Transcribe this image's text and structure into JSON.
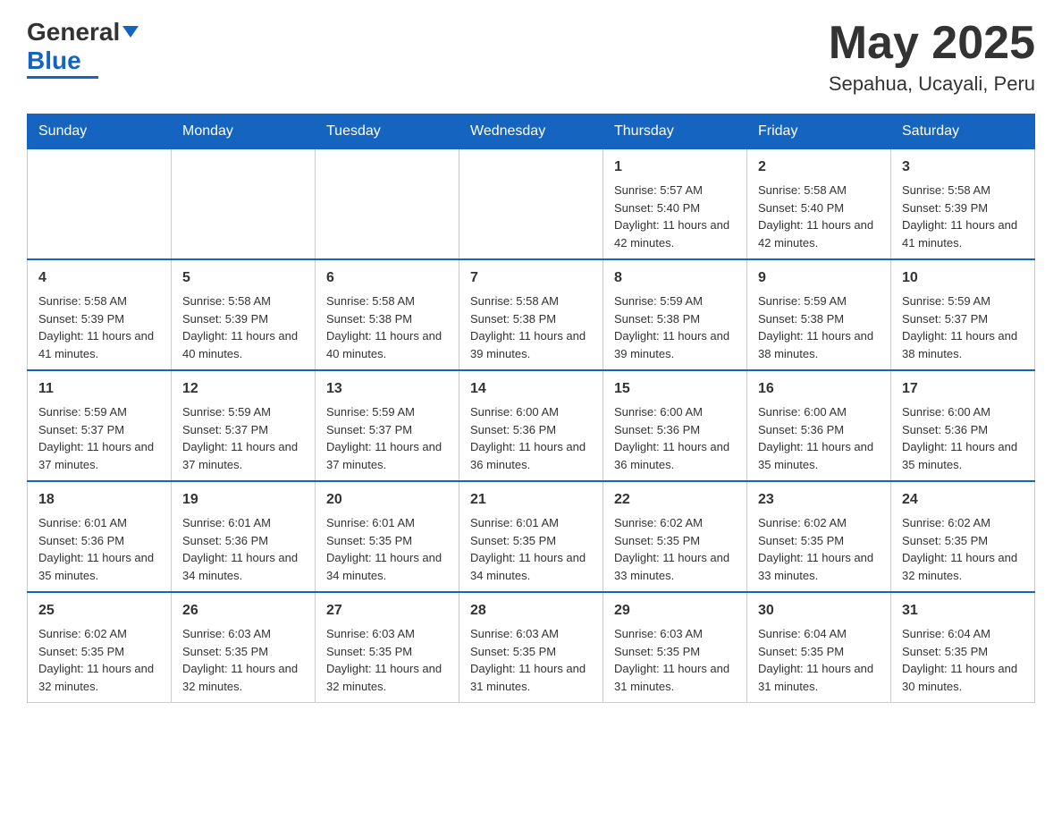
{
  "header": {
    "logo_general": "General",
    "logo_blue": "Blue",
    "month_year": "May 2025",
    "location": "Sepahua, Ucayali, Peru"
  },
  "days_of_week": [
    "Sunday",
    "Monday",
    "Tuesday",
    "Wednesday",
    "Thursday",
    "Friday",
    "Saturday"
  ],
  "weeks": [
    [
      {
        "day": "",
        "info": ""
      },
      {
        "day": "",
        "info": ""
      },
      {
        "day": "",
        "info": ""
      },
      {
        "day": "",
        "info": ""
      },
      {
        "day": "1",
        "info": "Sunrise: 5:57 AM\nSunset: 5:40 PM\nDaylight: 11 hours and 42 minutes."
      },
      {
        "day": "2",
        "info": "Sunrise: 5:58 AM\nSunset: 5:40 PM\nDaylight: 11 hours and 42 minutes."
      },
      {
        "day": "3",
        "info": "Sunrise: 5:58 AM\nSunset: 5:39 PM\nDaylight: 11 hours and 41 minutes."
      }
    ],
    [
      {
        "day": "4",
        "info": "Sunrise: 5:58 AM\nSunset: 5:39 PM\nDaylight: 11 hours and 41 minutes."
      },
      {
        "day": "5",
        "info": "Sunrise: 5:58 AM\nSunset: 5:39 PM\nDaylight: 11 hours and 40 minutes."
      },
      {
        "day": "6",
        "info": "Sunrise: 5:58 AM\nSunset: 5:38 PM\nDaylight: 11 hours and 40 minutes."
      },
      {
        "day": "7",
        "info": "Sunrise: 5:58 AM\nSunset: 5:38 PM\nDaylight: 11 hours and 39 minutes."
      },
      {
        "day": "8",
        "info": "Sunrise: 5:59 AM\nSunset: 5:38 PM\nDaylight: 11 hours and 39 minutes."
      },
      {
        "day": "9",
        "info": "Sunrise: 5:59 AM\nSunset: 5:38 PM\nDaylight: 11 hours and 38 minutes."
      },
      {
        "day": "10",
        "info": "Sunrise: 5:59 AM\nSunset: 5:37 PM\nDaylight: 11 hours and 38 minutes."
      }
    ],
    [
      {
        "day": "11",
        "info": "Sunrise: 5:59 AM\nSunset: 5:37 PM\nDaylight: 11 hours and 37 minutes."
      },
      {
        "day": "12",
        "info": "Sunrise: 5:59 AM\nSunset: 5:37 PM\nDaylight: 11 hours and 37 minutes."
      },
      {
        "day": "13",
        "info": "Sunrise: 5:59 AM\nSunset: 5:37 PM\nDaylight: 11 hours and 37 minutes."
      },
      {
        "day": "14",
        "info": "Sunrise: 6:00 AM\nSunset: 5:36 PM\nDaylight: 11 hours and 36 minutes."
      },
      {
        "day": "15",
        "info": "Sunrise: 6:00 AM\nSunset: 5:36 PM\nDaylight: 11 hours and 36 minutes."
      },
      {
        "day": "16",
        "info": "Sunrise: 6:00 AM\nSunset: 5:36 PM\nDaylight: 11 hours and 35 minutes."
      },
      {
        "day": "17",
        "info": "Sunrise: 6:00 AM\nSunset: 5:36 PM\nDaylight: 11 hours and 35 minutes."
      }
    ],
    [
      {
        "day": "18",
        "info": "Sunrise: 6:01 AM\nSunset: 5:36 PM\nDaylight: 11 hours and 35 minutes."
      },
      {
        "day": "19",
        "info": "Sunrise: 6:01 AM\nSunset: 5:36 PM\nDaylight: 11 hours and 34 minutes."
      },
      {
        "day": "20",
        "info": "Sunrise: 6:01 AM\nSunset: 5:35 PM\nDaylight: 11 hours and 34 minutes."
      },
      {
        "day": "21",
        "info": "Sunrise: 6:01 AM\nSunset: 5:35 PM\nDaylight: 11 hours and 34 minutes."
      },
      {
        "day": "22",
        "info": "Sunrise: 6:02 AM\nSunset: 5:35 PM\nDaylight: 11 hours and 33 minutes."
      },
      {
        "day": "23",
        "info": "Sunrise: 6:02 AM\nSunset: 5:35 PM\nDaylight: 11 hours and 33 minutes."
      },
      {
        "day": "24",
        "info": "Sunrise: 6:02 AM\nSunset: 5:35 PM\nDaylight: 11 hours and 32 minutes."
      }
    ],
    [
      {
        "day": "25",
        "info": "Sunrise: 6:02 AM\nSunset: 5:35 PM\nDaylight: 11 hours and 32 minutes."
      },
      {
        "day": "26",
        "info": "Sunrise: 6:03 AM\nSunset: 5:35 PM\nDaylight: 11 hours and 32 minutes."
      },
      {
        "day": "27",
        "info": "Sunrise: 6:03 AM\nSunset: 5:35 PM\nDaylight: 11 hours and 32 minutes."
      },
      {
        "day": "28",
        "info": "Sunrise: 6:03 AM\nSunset: 5:35 PM\nDaylight: 11 hours and 31 minutes."
      },
      {
        "day": "29",
        "info": "Sunrise: 6:03 AM\nSunset: 5:35 PM\nDaylight: 11 hours and 31 minutes."
      },
      {
        "day": "30",
        "info": "Sunrise: 6:04 AM\nSunset: 5:35 PM\nDaylight: 11 hours and 31 minutes."
      },
      {
        "day": "31",
        "info": "Sunrise: 6:04 AM\nSunset: 5:35 PM\nDaylight: 11 hours and 30 minutes."
      }
    ]
  ],
  "colors": {
    "header_bg": "#1565c0",
    "header_text": "#ffffff",
    "border": "#1565c0",
    "text": "#333333",
    "blue": "#1565c0"
  }
}
